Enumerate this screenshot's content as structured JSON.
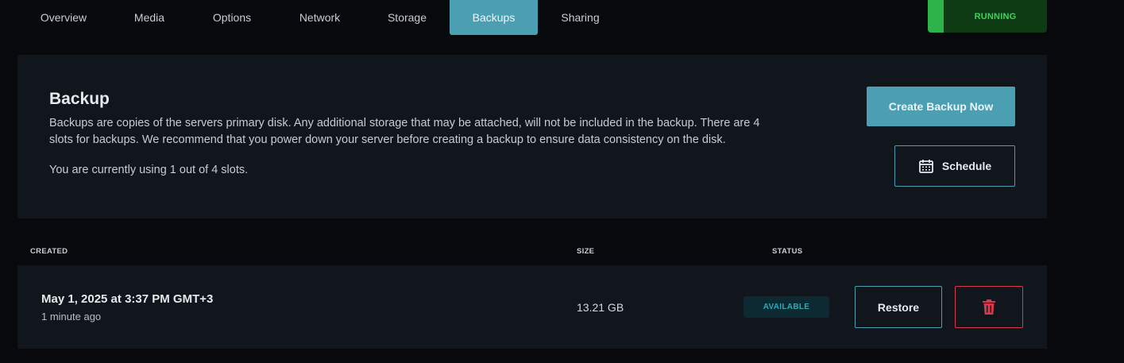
{
  "tabs": [
    {
      "label": "Overview",
      "active": false
    },
    {
      "label": "Media",
      "active": false
    },
    {
      "label": "Options",
      "active": false
    },
    {
      "label": "Network",
      "active": false
    },
    {
      "label": "Storage",
      "active": false
    },
    {
      "label": "Backups",
      "active": true
    },
    {
      "label": "Sharing",
      "active": false
    }
  ],
  "server_status": {
    "label": "RUNNING",
    "color": "#2eb34a"
  },
  "backup_panel": {
    "title": "Backup",
    "description": "Backups are copies of the servers primary disk. Any additional storage that may be attached, will not be included in the backup. There are 4 slots for backups. We recommend that you power down your server before creating a backup to ensure data consistency on the disk.",
    "usage": "You are currently using 1 out of 4 slots.",
    "create_button": "Create Backup Now",
    "schedule_button": "Schedule",
    "schedule_icon": "calendar-icon"
  },
  "table": {
    "headers": {
      "created": "CREATED",
      "size": "SIZE",
      "status": "STATUS"
    },
    "rows": [
      {
        "created": "May 1, 2025 at 3:37 PM GMT+3",
        "relative": "1 minute ago",
        "size": "13.21 GB",
        "status": "AVAILABLE",
        "restore_label": "Restore",
        "delete_icon": "trash-icon"
      }
    ]
  },
  "colors": {
    "accent": "#4a9fb3",
    "background": "#07090d",
    "panel": "#11151c",
    "danger": "#d13b4b",
    "status_available": "#2fa8b8"
  }
}
